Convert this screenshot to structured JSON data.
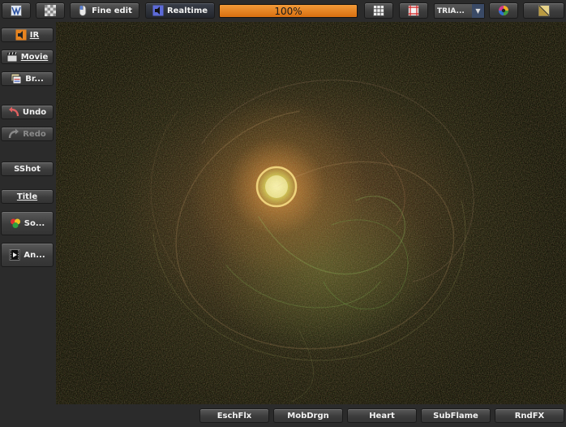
{
  "toolbar": {
    "fine_edit_label": "Fine edit",
    "realtime_label": "Realtime",
    "progress_text": "100%",
    "progress_value": 100,
    "render_mode_value": "TRIA...",
    "icons": [
      "random-flame-icon",
      "transparency-grid-icon",
      "mouse-icon",
      "speaker-icon",
      "grid-icon",
      "crop-frame-icon",
      "color-wheel-icon",
      "gradient-icon"
    ]
  },
  "sidebar": {
    "ir_label": "IR",
    "movie_label": "Movie",
    "batch_label": "Br...",
    "undo_label": "Undo",
    "redo_label": "Redo",
    "sshot_label": "SShot",
    "title_label": "Title",
    "solid_label": "So...",
    "anim_label": "An..."
  },
  "bottom": {
    "buttons": [
      "EschFlx",
      "MobDrgn",
      "Heart",
      "SubFlame",
      "RndFX"
    ]
  },
  "colors": {
    "accent": "#e8841f",
    "panel": "#2b2b2b",
    "button": "#444444"
  }
}
